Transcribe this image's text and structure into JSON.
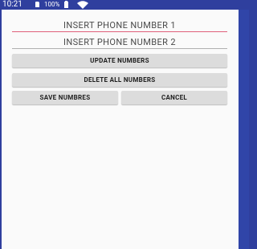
{
  "status_bar": {
    "time": "10:21",
    "battery_percent": "100%",
    "sd_icon": "sd-card-icon",
    "battery_icon": "battery-full-icon",
    "wifi_icon": "wifi-icon",
    "background_color": "#2f3f9e",
    "text_color": "#ffffff"
  },
  "form": {
    "phone1": {
      "placeholder": "INSERT PHONE NUMBER 1",
      "value": "",
      "underline_color": "#e0607a",
      "focused": true
    },
    "phone2": {
      "placeholder": "INSERT PHONE NUMBER 2",
      "value": "",
      "underline_color": "#b0b0b0",
      "focused": false
    }
  },
  "buttons": {
    "update_label": "UPDATE NUMBERS",
    "delete_label": "DELETE ALL NUMBERS",
    "save_label": "SAVE NUMBRES",
    "cancel_label": "CANCEL"
  },
  "colors": {
    "app_background": "#fafafa",
    "button_background": "#dcdcdc",
    "accent": "#e0607a"
  }
}
